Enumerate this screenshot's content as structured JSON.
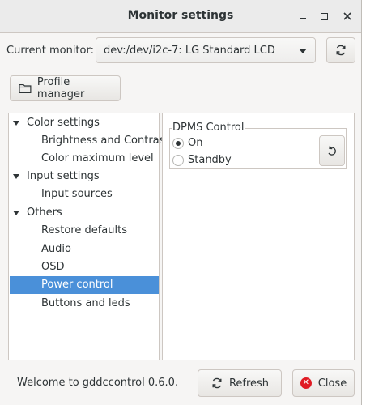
{
  "window": {
    "title": "Monitor settings",
    "controls": [
      "minimize",
      "maximize",
      "close"
    ]
  },
  "monitor": {
    "label": "Current monitor:",
    "selected": "dev:/dev/i2c-7: LG Standard LCD",
    "refresh_icon": "refresh-icon"
  },
  "profile_manager": {
    "label": "Profile manager",
    "icon": "folder-icon"
  },
  "tree": {
    "items": [
      {
        "label": "Color settings",
        "level": 0,
        "expanded": true
      },
      {
        "label": "Brightness and Contrast",
        "level": 1
      },
      {
        "label": "Color maximum level",
        "level": 1
      },
      {
        "label": "Input settings",
        "level": 0,
        "expanded": true
      },
      {
        "label": "Input sources",
        "level": 1
      },
      {
        "label": "Others",
        "level": 0,
        "expanded": true
      },
      {
        "label": "Restore defaults",
        "level": 1
      },
      {
        "label": "Audio",
        "level": 1
      },
      {
        "label": "OSD",
        "level": 1
      },
      {
        "label": "Power control",
        "level": 1,
        "selected": true
      },
      {
        "label": "Buttons and leds",
        "level": 1
      }
    ]
  },
  "dpms": {
    "title": "DPMS Control",
    "options": [
      {
        "label": "On",
        "checked": true
      },
      {
        "label": "Standby",
        "checked": false
      }
    ],
    "revert_icon": "undo-icon"
  },
  "status": {
    "text": "Welcome to gddccontrol 0.6.0."
  },
  "buttons": {
    "refresh": "Refresh",
    "close": "Close"
  },
  "colors": {
    "selection": "#4a90d9",
    "close_icon": "#e01b24"
  }
}
